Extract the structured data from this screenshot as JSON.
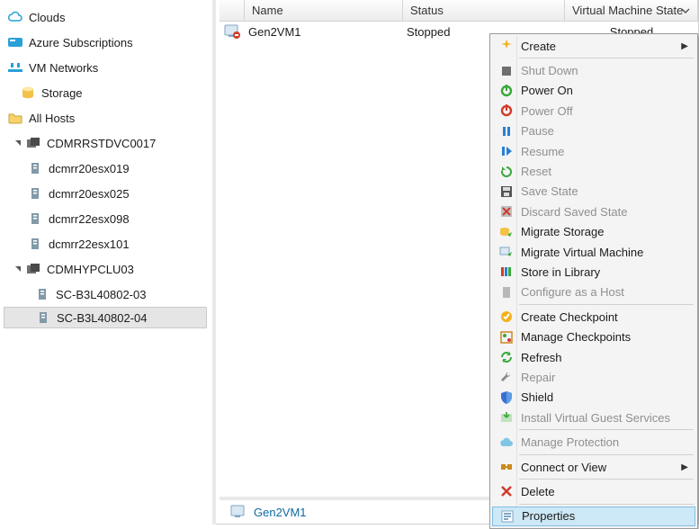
{
  "nav": {
    "clouds": "Clouds",
    "azure": "Azure Subscriptions",
    "vmnet": "VM Networks",
    "storage": "Storage",
    "allhosts": "All Hosts",
    "cluster1": "CDMRRSTDVC0017",
    "c1hosts": [
      "dcmrr20esx019",
      "dcmrr20esx025",
      "dcmrr22esx098",
      "dcmrr22esx101"
    ],
    "cluster2": "CDMHYPCLU03",
    "c2hosts": [
      "SC-B3L40802-03",
      "SC-B3L40802-04"
    ]
  },
  "grid": {
    "headers": {
      "name": "Name",
      "status": "Status",
      "vmstate": "Virtual Machine State"
    },
    "row": {
      "name": "Gen2VM1",
      "status": "Stopped",
      "vmstate": "Stopped"
    }
  },
  "status": {
    "selected": "Gen2VM1"
  },
  "menu": {
    "create": "Create",
    "shutdown": "Shut Down",
    "poweron": "Power On",
    "poweroff": "Power Off",
    "pause": "Pause",
    "resume": "Resume",
    "reset": "Reset",
    "savestate": "Save State",
    "discard": "Discard Saved State",
    "migratestorage": "Migrate Storage",
    "migratevm": "Migrate Virtual Machine",
    "storelib": "Store in Library",
    "confighost": "Configure as a Host",
    "createcp": "Create Checkpoint",
    "managecp": "Manage Checkpoints",
    "refresh": "Refresh",
    "repair": "Repair",
    "shield": "Shield",
    "installguest": "Install Virtual Guest Services",
    "manageprot": "Manage Protection",
    "connect": "Connect or View",
    "delete": "Delete",
    "properties": "Properties"
  }
}
